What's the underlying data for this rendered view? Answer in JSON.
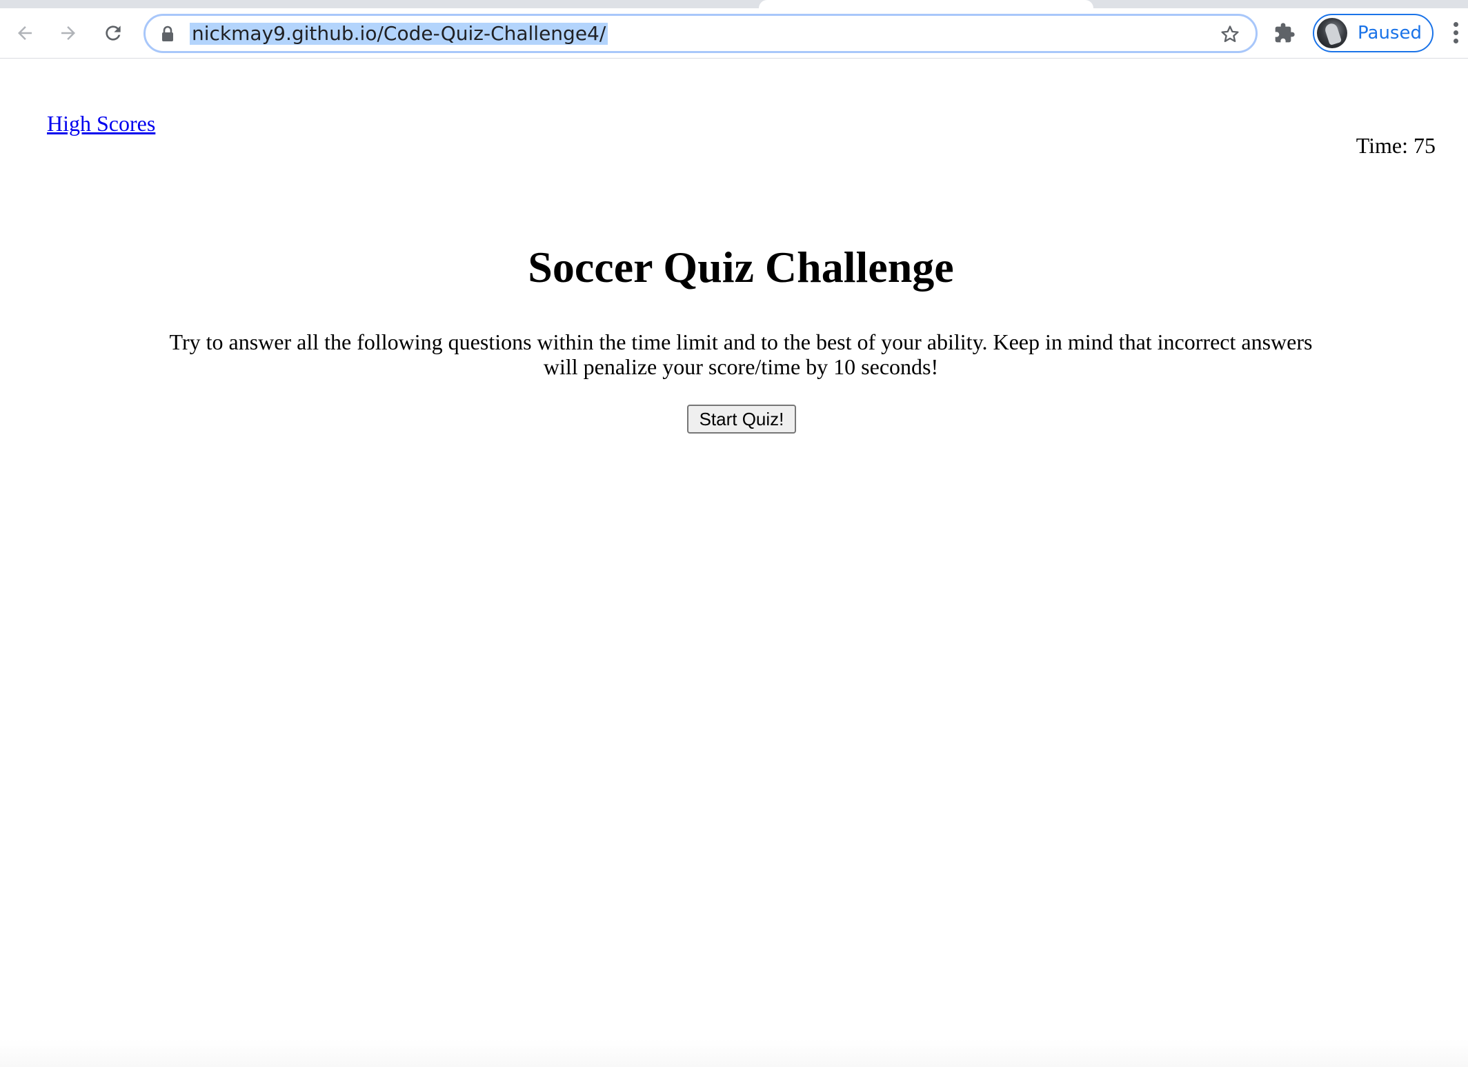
{
  "browser": {
    "url": "nickmay9.github.io/Code-Quiz-Challenge4/",
    "profile_status": "Paused",
    "icons": {
      "back": "back-arrow-icon",
      "forward": "forward-arrow-icon",
      "reload": "reload-icon",
      "secure": "lock-icon",
      "bookmark": "star-icon",
      "extensions": "puzzle-icon",
      "menu": "kebab-menu-icon"
    },
    "colors": {
      "url_selection": "#b3d4fc",
      "omnibox_focus": "#a8c7fa",
      "profile_accent": "#1a73e8"
    }
  },
  "page": {
    "high_scores_link": "High Scores",
    "timer_label": "Time:",
    "timer_value": "75",
    "title": "Soccer Quiz Challenge",
    "intro": "Try to answer all the following questions within the time limit and to the best of your ability. Keep in mind that incorrect answers will penalize your score/time by 10 seconds!",
    "start_button": "Start Quiz!",
    "colors": {
      "link": "#0000ee",
      "text": "#000000"
    }
  }
}
